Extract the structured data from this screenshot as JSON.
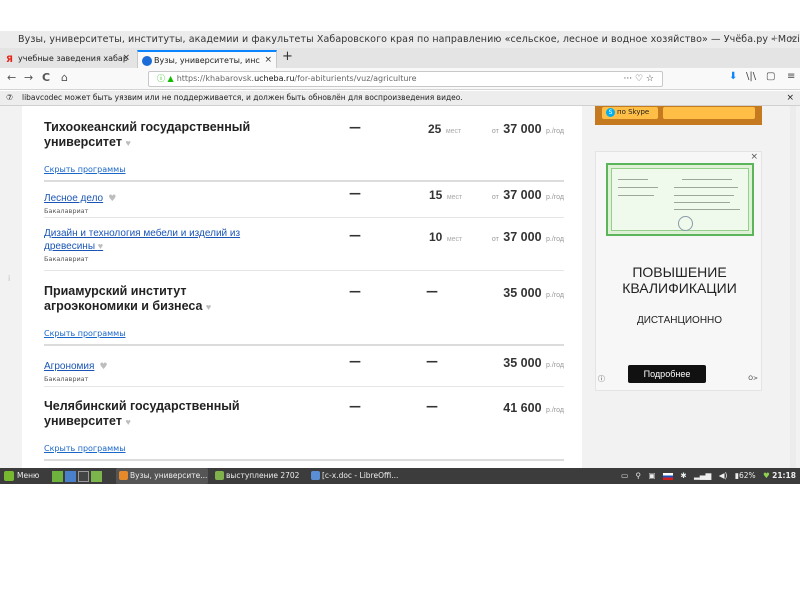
{
  "browser": {
    "window_title": "Вузы, университеты, институты, академии и факультеты Хабаровского края по направлению «сельское, лесное и водное хозяйство» — Учёба.ру - Mozilla Firefox",
    "window_controls": [
      "–",
      "+",
      "×"
    ],
    "tabs": [
      {
        "title": "учебные заведения хабар",
        "favicon": "Я",
        "close": "×",
        "active": false
      },
      {
        "title": "Вузы, университеты, инс",
        "favicon": "",
        "close": "×",
        "active": true
      }
    ],
    "new_tab": "+",
    "nav": {
      "back": "←",
      "forward": "→",
      "reload": "C",
      "home": "⌂"
    },
    "url": {
      "prefix": "https://khabarovsk.",
      "host": "ucheba.ru",
      "path": "/for-abiturients/vuz/agriculture",
      "page_actions": "···  ♡  ☆"
    },
    "toolbar_right": {
      "download": "⬇",
      "library": "\\|\\",
      "sidebar": "▢",
      "menu": "≡"
    },
    "notification": {
      "text": "libavcodec может быть уязвим или не поддерживается, и должен быть обновлён для воспроизведения видео.",
      "close": "×"
    }
  },
  "listing": {
    "currency_prefix": "от",
    "unit_suffix": "р./год",
    "seats_suffix": "мест",
    "dash": "—",
    "hide_programs": "Скрыть программы",
    "universities": [
      {
        "name_l1": "Тихоокеанский государственный",
        "name_l2": "университет",
        "seats": "25",
        "price": "37 000",
        "price_from": true
      },
      {
        "name_l1": "Приамурский институт",
        "name_l2": "агроэкономики и бизнеса",
        "seats": "",
        "price": "35 000",
        "price_from": false
      },
      {
        "name_l1": "Челябинский государственный",
        "name_l2": "университет",
        "seats": "",
        "price": "41 600",
        "price_from": false
      }
    ],
    "programs": [
      {
        "name_l1": "Лесное дело",
        "name_l2": "",
        "level": "Бакалавриат",
        "seats": "15",
        "price": "37 000"
      },
      {
        "name_l1": "Дизайн и технология мебели и изделий из",
        "name_l2": "древесины",
        "level": "Бакалавриат",
        "seats": "10",
        "price": "37 000"
      },
      {
        "name_l1": "Агрономия",
        "name_l2": "",
        "level": "Бакалавриат",
        "seats": "",
        "price": "35 000"
      }
    ]
  },
  "ads": {
    "skype": {
      "label": "по Skype",
      "icon": "S"
    },
    "qualification": {
      "headline_l1": "ПОВЫШЕНИЕ",
      "headline_l2": "КВАЛИФИКАЦИИ",
      "subline": "ДИСТАНЦИОННО",
      "button": "Подробнее",
      "close": "×",
      "info": "ⓘ",
      "logo": "О>"
    }
  },
  "taskbar": {
    "menu": "Меню",
    "windows": [
      "Вузы, университе...",
      "выступление 2702",
      "[c-x.doc - LibreOffi..."
    ],
    "tray": {
      "battery": "62%",
      "time": "21:18"
    }
  },
  "colors": {
    "link": "#1a55b5",
    "ad_orange": "#c67a1f",
    "cert_green": "#5cb55a",
    "firefox_blue": "#0a84ff"
  }
}
